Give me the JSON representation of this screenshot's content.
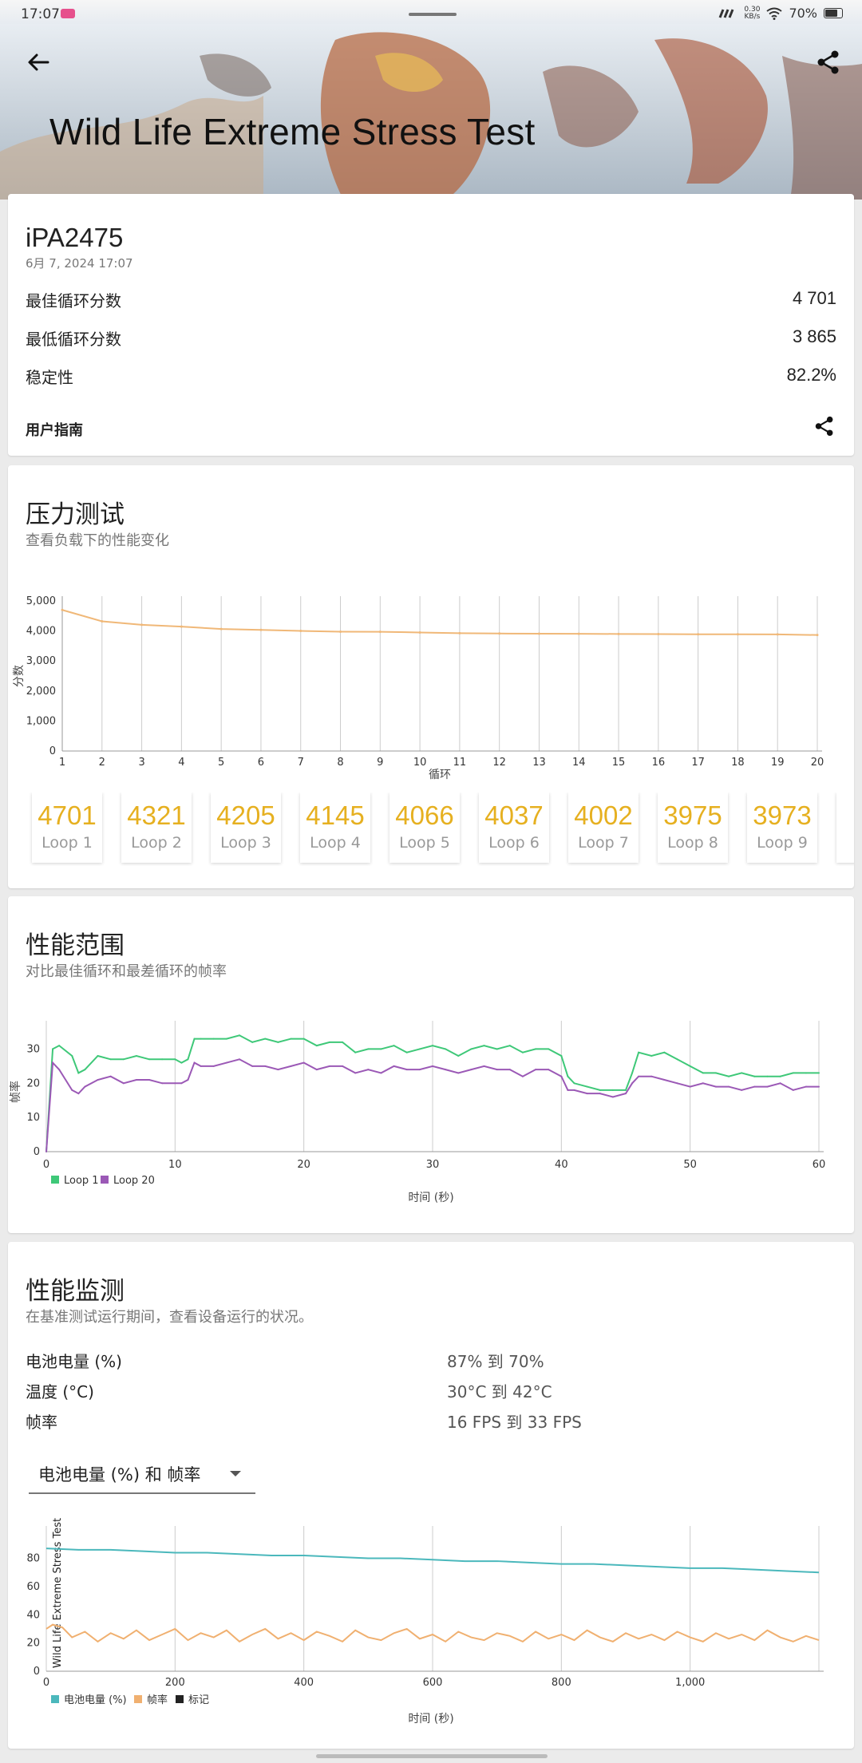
{
  "status_bar": {
    "time": "17:07",
    "net_speed_value": "0.30",
    "net_speed_unit": "KB/s",
    "battery": "70%",
    "battery_level": 0.7
  },
  "header": {
    "title": "Wild Life Extreme Stress Test",
    "back_icon": "arrow-left-icon",
    "share_icon": "share-icon"
  },
  "summary": {
    "device": "iPA2475",
    "date": "6月 7, 2024 17:07",
    "rows": [
      {
        "label": "最佳循环分数",
        "value": "4 701"
      },
      {
        "label": "最低循环分数",
        "value": "3 865"
      },
      {
        "label": "稳定性",
        "value": "82.2%"
      }
    ],
    "guide_label": "用户指南"
  },
  "stress": {
    "title": "压力测试",
    "subtitle": "查看负载下的性能变化",
    "chart_data": {
      "type": "line",
      "xlabel": "循环",
      "ylabel": "分数",
      "ylim": [
        0,
        5000
      ],
      "yticks": [
        "0",
        "1,000",
        "2,000",
        "3,000",
        "4,000",
        "5,000"
      ],
      "x": [
        1,
        2,
        3,
        4,
        5,
        6,
        7,
        8,
        9,
        10,
        11,
        12,
        13,
        14,
        15,
        16,
        17,
        18,
        19,
        20
      ],
      "series": [
        {
          "values": [
            4701,
            4321,
            4205,
            4145,
            4066,
            4037,
            4002,
            3975,
            3973,
            3950,
            3925,
            3915,
            3910,
            3905,
            3900,
            3895,
            3890,
            3890,
            3885,
            3865
          ],
          "color": "#f0b878"
        }
      ],
      "grid": "vertical"
    },
    "loops": [
      {
        "score": "4701",
        "label": "Loop 1"
      },
      {
        "score": "4321",
        "label": "Loop 2"
      },
      {
        "score": "4205",
        "label": "Loop 3"
      },
      {
        "score": "4145",
        "label": "Loop 4"
      },
      {
        "score": "4066",
        "label": "Loop 5"
      },
      {
        "score": "4037",
        "label": "Loop 6"
      },
      {
        "score": "4002",
        "label": "Loop 7"
      },
      {
        "score": "3975",
        "label": "Loop 8"
      },
      {
        "score": "3973",
        "label": "Loop 9"
      }
    ]
  },
  "range": {
    "title": "性能范围",
    "subtitle": "对比最佳循环和最差循环的帧率",
    "chart_data": {
      "type": "line",
      "xlabel": "时间 (秒)",
      "ylabel": "帧率",
      "xlim": [
        0,
        60
      ],
      "ylim": [
        0,
        35
      ],
      "xticks": [
        "0",
        "10",
        "20",
        "30",
        "40",
        "50",
        "60"
      ],
      "yticks": [
        "0",
        "10",
        "20",
        "30"
      ],
      "legend_position": "bottom-left",
      "series": [
        {
          "name": "Loop 1",
          "color": "#3ec878",
          "x": [
            0,
            0.5,
            1,
            2,
            2.5,
            3,
            4,
            5,
            6,
            7,
            8,
            9,
            10,
            10.5,
            11,
            11.5,
            12,
            13,
            14,
            15,
            16,
            17,
            18,
            19,
            20,
            21,
            22,
            23,
            24,
            25,
            26,
            27,
            28,
            29,
            30,
            31,
            32,
            33,
            34,
            35,
            36,
            37,
            38,
            39,
            40,
            40.5,
            41,
            42,
            43,
            44,
            45,
            45.5,
            46,
            47,
            48,
            49,
            50,
            51,
            52,
            53,
            54,
            55,
            56,
            57,
            58,
            59,
            60
          ],
          "y": [
            0,
            30,
            31,
            28,
            23,
            24,
            28,
            27,
            27,
            28,
            27,
            27,
            27,
            26,
            27,
            33,
            33,
            33,
            33,
            34,
            32,
            33,
            32,
            33,
            33,
            31,
            32,
            32,
            29,
            30,
            30,
            31,
            29,
            30,
            31,
            30,
            28,
            30,
            31,
            30,
            31,
            29,
            30,
            30,
            28,
            22,
            20,
            19,
            18,
            18,
            18,
            23,
            29,
            28,
            29,
            27,
            25,
            23,
            23,
            22,
            23,
            22,
            22,
            22,
            23,
            23,
            23
          ]
        },
        {
          "name": "Loop 20",
          "color": "#9b59b6",
          "x": [
            0,
            0.5,
            1,
            2,
            2.5,
            3,
            4,
            5,
            6,
            7,
            8,
            9,
            10,
            10.5,
            11,
            11.5,
            12,
            13,
            14,
            15,
            16,
            17,
            18,
            19,
            20,
            21,
            22,
            23,
            24,
            25,
            26,
            27,
            28,
            29,
            30,
            31,
            32,
            33,
            34,
            35,
            36,
            37,
            38,
            39,
            40,
            40.5,
            41,
            42,
            43,
            44,
            45,
            45.5,
            46,
            47,
            48,
            49,
            50,
            51,
            52,
            53,
            54,
            55,
            56,
            57,
            58,
            59,
            60
          ],
          "y": [
            0,
            26,
            24,
            18,
            17,
            19,
            21,
            22,
            20,
            21,
            21,
            20,
            20,
            20,
            21,
            26,
            25,
            25,
            26,
            27,
            25,
            25,
            24,
            25,
            26,
            24,
            25,
            25,
            23,
            24,
            23,
            25,
            24,
            24,
            25,
            24,
            23,
            24,
            25,
            24,
            24,
            22,
            24,
            24,
            22,
            18,
            18,
            17,
            17,
            16,
            17,
            20,
            22,
            22,
            21,
            20,
            19,
            20,
            19,
            19,
            18,
            19,
            19,
            20,
            18,
            19,
            19
          ]
        }
      ]
    }
  },
  "monitor": {
    "title": "性能监测",
    "subtitle": "在基准测试运行期间，查看设备运行的状况。",
    "rows": [
      {
        "label": "电池电量 (%)",
        "value": "87% 到 70%"
      },
      {
        "label": "温度 (°C)",
        "value": "30°C 到 42°C"
      },
      {
        "label": "帧率",
        "value": "16 FPS 到 33 FPS"
      }
    ],
    "dropdown_value": "电池电量 (%) 和 帧率",
    "chart_data": {
      "type": "line",
      "xlabel": "时间 (秒)",
      "ylabel": "Wild Life Extreme Stress Test",
      "xlim": [
        0,
        1200
      ],
      "ylim": [
        0,
        95
      ],
      "xticks": [
        "0",
        "200",
        "400",
        "600",
        "800",
        "1,000"
      ],
      "yticks": [
        "0",
        "20",
        "40",
        "60",
        "80"
      ],
      "legend": [
        "电池电量 (%)",
        "帧率",
        "标记"
      ],
      "legend_colors": [
        "#4bb8bc",
        "#f0b070",
        "#222222"
      ],
      "series": [
        {
          "name": "电池电量 (%)",
          "color": "#4bb8bc",
          "x": [
            0,
            50,
            100,
            150,
            200,
            250,
            300,
            350,
            400,
            450,
            500,
            550,
            600,
            650,
            700,
            750,
            800,
            850,
            900,
            950,
            1000,
            1050,
            1100,
            1150,
            1200
          ],
          "y": [
            87,
            86,
            86,
            85,
            84,
            84,
            83,
            82,
            82,
            81,
            80,
            80,
            79,
            78,
            78,
            77,
            76,
            76,
            75,
            74,
            73,
            73,
            72,
            71,
            70
          ]
        },
        {
          "name": "帧率",
          "color": "#f0b070",
          "x": [
            0,
            10,
            25,
            40,
            60,
            80,
            100,
            120,
            140,
            160,
            180,
            200,
            220,
            240,
            260,
            280,
            300,
            320,
            340,
            360,
            380,
            400,
            420,
            440,
            460,
            480,
            500,
            520,
            540,
            560,
            580,
            600,
            620,
            640,
            660,
            680,
            700,
            720,
            740,
            760,
            780,
            800,
            820,
            840,
            860,
            880,
            900,
            920,
            940,
            960,
            980,
            1000,
            1020,
            1040,
            1060,
            1080,
            1100,
            1120,
            1140,
            1160,
            1180,
            1200
          ],
          "y": [
            30,
            33,
            31,
            24,
            28,
            21,
            27,
            23,
            29,
            22,
            26,
            30,
            22,
            27,
            24,
            29,
            21,
            26,
            30,
            23,
            27,
            22,
            28,
            25,
            21,
            29,
            24,
            22,
            27,
            30,
            23,
            26,
            21,
            28,
            24,
            22,
            27,
            25,
            21,
            28,
            23,
            26,
            22,
            29,
            24,
            21,
            27,
            23,
            26,
            22,
            28,
            24,
            21,
            27,
            23,
            26,
            22,
            29,
            24,
            21,
            25,
            22
          ]
        }
      ]
    }
  }
}
